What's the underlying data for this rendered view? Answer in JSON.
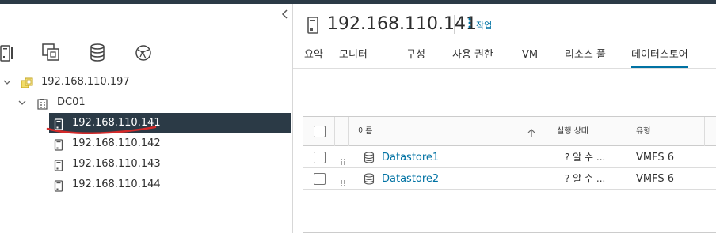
{
  "navigator": {
    "collapse_icon": "chevron-left-icon",
    "tabs": [
      {
        "icon": "hosts-clusters-icon",
        "active": true
      },
      {
        "icon": "vms-templates-icon",
        "active": false
      },
      {
        "icon": "storage-icon",
        "active": false
      },
      {
        "icon": "networking-icon",
        "active": false
      }
    ],
    "tree": [
      {
        "label": "192.168.110.197",
        "type": "vcenter",
        "level": 0,
        "expanded": true
      },
      {
        "label": "DC01",
        "type": "datacenter",
        "level": 1,
        "expanded": true
      },
      {
        "label": "192.168.110.141",
        "type": "host",
        "level": 2,
        "selected": true
      },
      {
        "label": "192.168.110.142",
        "type": "host",
        "level": 2
      },
      {
        "label": "192.168.110.143",
        "type": "host",
        "level": 2
      },
      {
        "label": "192.168.110.144",
        "type": "host",
        "level": 2
      }
    ]
  },
  "object": {
    "title": "192.168.110.141",
    "icon": "host-icon",
    "actions_label": "작업"
  },
  "tabs": [
    {
      "label": "요약",
      "active": false
    },
    {
      "label": "모니터",
      "active": false
    },
    {
      "label": "구성",
      "active": false
    },
    {
      "label": "사용 권한",
      "active": false
    },
    {
      "label": "VM",
      "active": false
    },
    {
      "label": "리소스 풀",
      "active": false
    },
    {
      "label": "데이터스토어",
      "active": true
    }
  ],
  "table": {
    "columns": [
      {
        "label": "이름",
        "sorted": "ascending"
      },
      {
        "label": "실행 상태"
      },
      {
        "label": "유형"
      }
    ],
    "rows": [
      {
        "name": "Datastore1",
        "status": "?  알 수 ...",
        "type": "VMFS 6"
      },
      {
        "name": "Datastore2",
        "status": "?  알 수 ...",
        "type": "VMFS 6"
      }
    ]
  },
  "colors": {
    "accent": "#0072a3",
    "selected_row_bg": "#2b3a46",
    "annotation_underline": "#d42a2a"
  }
}
